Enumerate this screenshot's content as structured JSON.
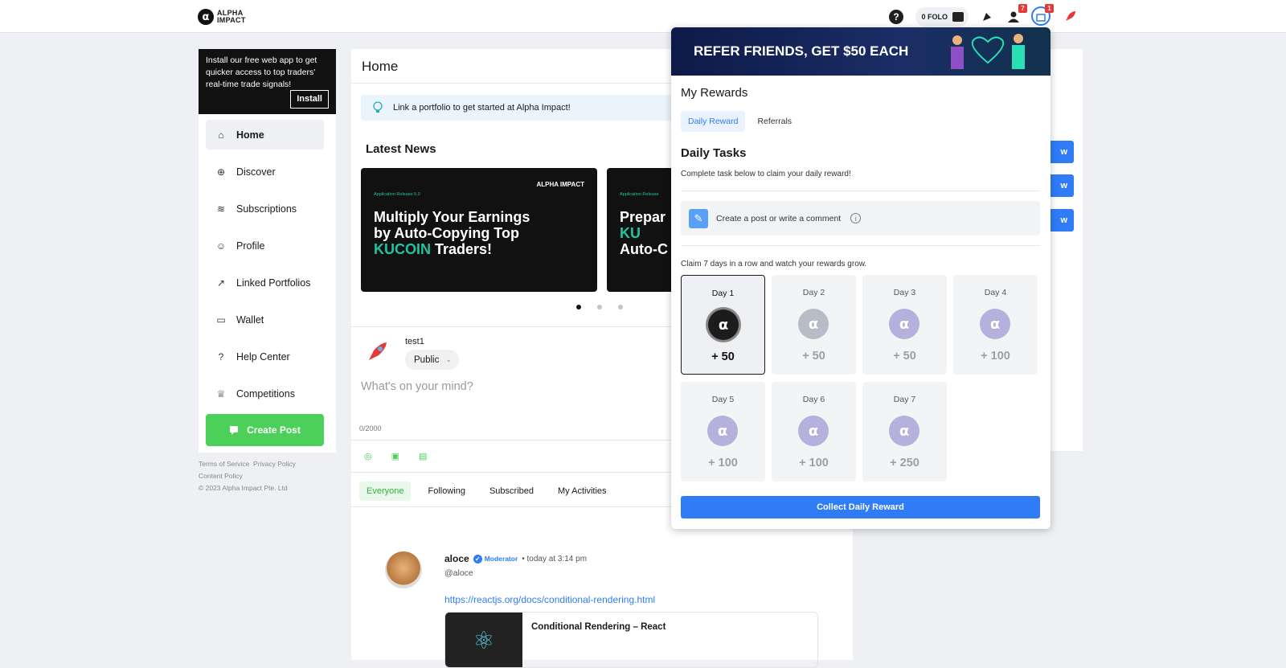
{
  "app": {
    "logo_mark": "α",
    "logo_line1": "ALPHA",
    "logo_line2": "IMPACT"
  },
  "topbar": {
    "help": "?",
    "folo": "0 FOLO",
    "notif_count": "7",
    "rewards_count": "1"
  },
  "banner": {
    "text": "Install our free web app to get quicker access to top traders' real-time trade signals!",
    "install": "Install"
  },
  "nav": {
    "items": [
      {
        "label": "Home",
        "icon": "⌂"
      },
      {
        "label": "Discover",
        "icon": "⊕"
      },
      {
        "label": "Subscriptions",
        "icon": "≋"
      },
      {
        "label": "Profile",
        "icon": "☺"
      },
      {
        "label": "Linked Portfolios",
        "icon": "↗"
      },
      {
        "label": "Wallet",
        "icon": "▭"
      },
      {
        "label": "Help Center",
        "icon": "?"
      },
      {
        "label": "Competitions",
        "icon": "♕"
      }
    ],
    "create_post": "Create Post"
  },
  "footer": {
    "terms": "Terms of Service",
    "privacy": "Privacy Policy",
    "content": "Content Policy",
    "copyright": "© 2023 Alpha Impact Pte. Ltd"
  },
  "main": {
    "title": "Home",
    "tip": "Link a portfolio to get started at Alpha Impact!",
    "news_title": "Latest News",
    "card1": {
      "small": "Application Release 5.0",
      "line1": "Multiply Your Earnings",
      "line2": "by Auto-Copying Top",
      "kucoin": "KUCOIN",
      "line3": "Traders!",
      "logo": "ALPHA IMPACT"
    },
    "card2": {
      "small": "Application Release",
      "line1": "Prepar",
      "kucoin": "KU",
      "line2": "Auto-C"
    },
    "composer": {
      "username": "test1",
      "visibility": "Public",
      "placeholder": "What's on your mind?",
      "counter": "0/2000"
    },
    "feed_tabs": [
      "Everyone",
      "Following",
      "Subscribed",
      "My Activities"
    ],
    "post": {
      "name": "aloce",
      "badge": "Moderator",
      "time": "• today at 3:14 pm",
      "handle": "@aloce",
      "link": "https://reactjs.org/docs/conditional-rendering.html",
      "card_title": "Conditional Rendering – React"
    }
  },
  "right": {
    "follow": "w"
  },
  "popup": {
    "promo": "REFER FRIENDS, GET $50 EACH",
    "title": "My Rewards",
    "tabs": [
      "Daily Reward",
      "Referrals"
    ],
    "daily_title": "Daily Tasks",
    "daily_sub": "Complete task below to claim your daily reward!",
    "task": "Create a post or write a comment",
    "claim_text": "Claim 7 days in a row and watch your rewards grow.",
    "days": [
      {
        "label": "Day 1",
        "amount": "+ 50"
      },
      {
        "label": "Day 2",
        "amount": "+ 50"
      },
      {
        "label": "Day 3",
        "amount": "+ 50"
      },
      {
        "label": "Day 4",
        "amount": "+ 100"
      },
      {
        "label": "Day 5",
        "amount": "+ 100"
      },
      {
        "label": "Day 6",
        "amount": "+ 100"
      },
      {
        "label": "Day 7",
        "amount": "+ 250"
      }
    ],
    "coin": "α",
    "collect": "Collect Daily Reward"
  }
}
